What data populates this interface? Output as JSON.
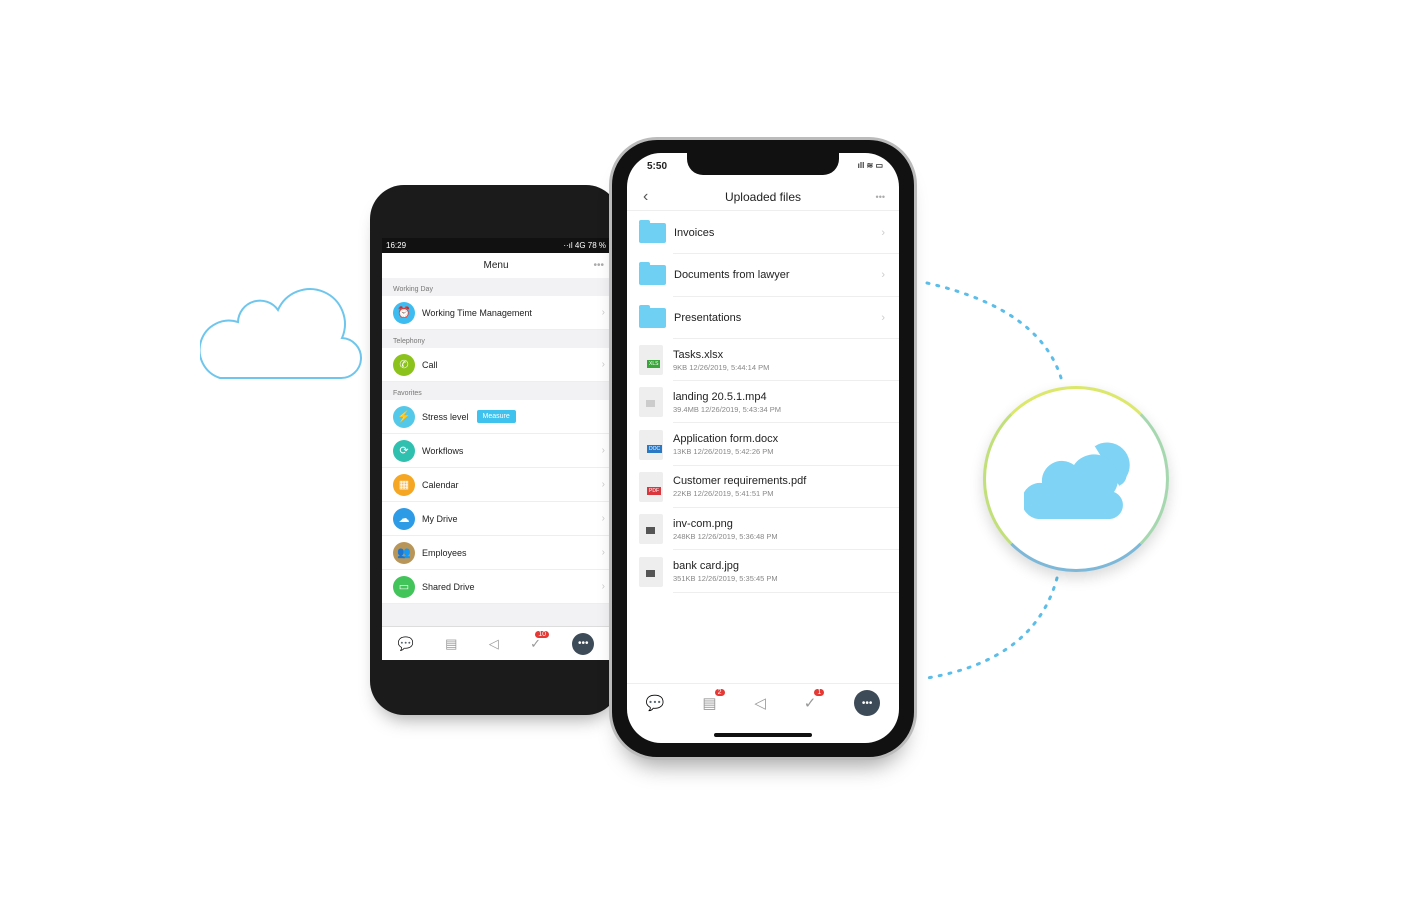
{
  "android": {
    "status": {
      "time": "16:29",
      "right": "··ıl 4G 78 %"
    },
    "title": "Menu",
    "sections": [
      {
        "label": "Working Day",
        "items": [
          {
            "label": "Working Time Management",
            "icon": "alarm-clock-icon",
            "color": "#3cbcf0"
          }
        ]
      },
      {
        "label": "Telephony",
        "items": [
          {
            "label": "Call",
            "icon": "phone-icon",
            "color": "#8cc21c"
          }
        ]
      },
      {
        "label": "Favorites",
        "items": [
          {
            "label": "Stress level",
            "icon": "lightning-icon",
            "color": "#54c8e8",
            "button": "Measure"
          },
          {
            "label": "Workflows",
            "icon": "workflow-icon",
            "color": "#2fc0b0"
          },
          {
            "label": "Calendar",
            "icon": "calendar-icon",
            "color": "#f5a623"
          },
          {
            "label": "My Drive",
            "icon": "drive-icon",
            "color": "#2e9be6"
          },
          {
            "label": "Employees",
            "icon": "employees-icon",
            "color": "#b8965a"
          },
          {
            "label": "Shared Drive",
            "icon": "shared-drive-icon",
            "color": "#43c45a"
          }
        ]
      }
    ],
    "tabbar_badge": "10"
  },
  "iphone": {
    "status_time": "5:50",
    "title": "Uploaded files",
    "folders": [
      "Invoices",
      "Documents from lawyer",
      "Presentations"
    ],
    "files": [
      {
        "name": "Tasks.xlsx",
        "meta": "9KB 12/26/2019, 5:44:14 PM",
        "tag": "XLS",
        "color": "#3aa53a"
      },
      {
        "name": "landing 20.5.1.mp4",
        "meta": "39.4MB 12/26/2019, 5:43:34 PM",
        "tag": "",
        "color": "#ccc"
      },
      {
        "name": "Application form.docx",
        "meta": "13KB 12/26/2019, 5:42:26 PM",
        "tag": "DOC",
        "color": "#2b78c4"
      },
      {
        "name": "Customer requirements.pdf",
        "meta": "22KB 12/26/2019, 5:41:51 PM",
        "tag": "PDF",
        "color": "#d9363e"
      },
      {
        "name": "inv-com.png",
        "meta": "248KB 12/26/2019, 5:36:48 PM",
        "tag": "",
        "color": "#555"
      },
      {
        "name": "bank card.jpg",
        "meta": "351KB 12/26/2019, 5:35:45 PM",
        "tag": "",
        "color": "#555"
      }
    ],
    "badges": {
      "feed": "2",
      "tasks": "1"
    }
  },
  "colors": {
    "accent": "#6fd0f4",
    "cloud": "#7fd3f5"
  }
}
